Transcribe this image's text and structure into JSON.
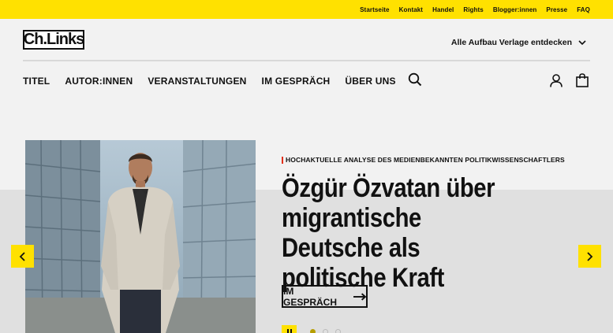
{
  "topbar": {
    "links": [
      "Startseite",
      "Kontakt",
      "Handel",
      "Rights",
      "Blogger:innen",
      "Presse",
      "FAQ"
    ]
  },
  "header": {
    "logo_text": "Ch.Links",
    "publisher_dropdown": "Alle Aufbau Verlage entdecken"
  },
  "nav": {
    "items": [
      "TITEL",
      "AUTOR:INNEN",
      "VERANSTALTUNGEN",
      "IM GESPRÄCH",
      "ÜBER UNS"
    ],
    "icons": [
      "search-icon",
      "user-icon",
      "shopping-bag-icon"
    ]
  },
  "hero": {
    "eyebrow": "HOCHAKTUELLE ANALYSE DES MEDIENBEKANNTEN POLITIKWISSENSCHAFTLERS",
    "headline": "Özgür Özvatan über migrantische Deutsche als politische Kraft",
    "cta_label": "IM GESPRÄCH",
    "slide_count": 3,
    "active_slide": 1
  },
  "colors": {
    "accent": "#ffe100",
    "eyebrow_marker": "#e2301b",
    "background": "#f2f2f2",
    "stage_band": "#e0e0e0"
  }
}
